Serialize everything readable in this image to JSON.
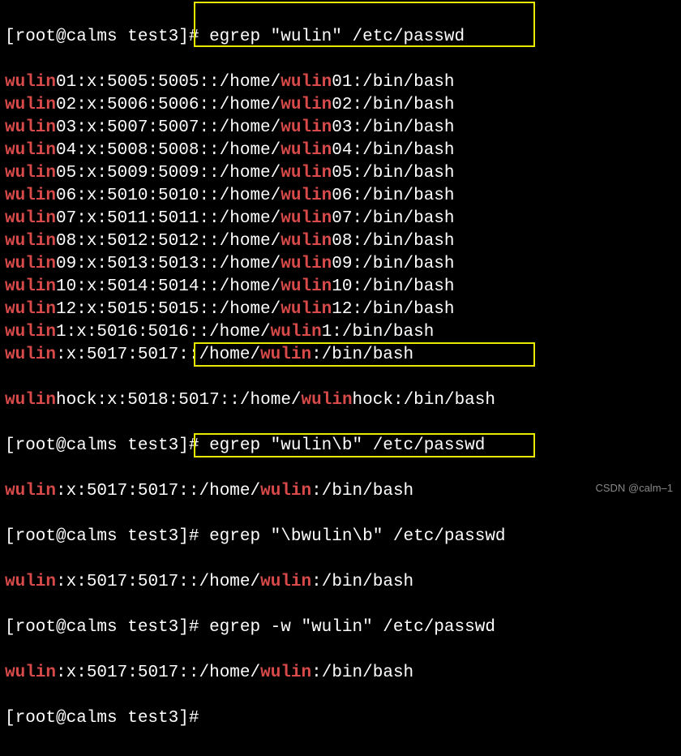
{
  "prompt": "[root@calms test3]#",
  "cmd1": "egrep \"wulin\" /etc/passwd",
  "cmd2": "egrep \"wulin\\b\" /etc/passwd",
  "cmd3": "egrep \"\\bwulin\\b\" /etc/passwd",
  "cmd4": "egrep -w \"wulin\" /etc/passwd",
  "match": "wulin",
  "rows": [
    {
      "n": "01",
      "uid": "5005",
      "gid": "5005",
      "home": "01"
    },
    {
      "n": "02",
      "uid": "5006",
      "gid": "5006",
      "home": "02"
    },
    {
      "n": "03",
      "uid": "5007",
      "gid": "5007",
      "home": "03"
    },
    {
      "n": "04",
      "uid": "5008",
      "gid": "5008",
      "home": "04"
    },
    {
      "n": "05",
      "uid": "5009",
      "gid": "5009",
      "home": "05"
    },
    {
      "n": "06",
      "uid": "5010",
      "gid": "5010",
      "home": "06"
    },
    {
      "n": "07",
      "uid": "5011",
      "gid": "5011",
      "home": "07"
    },
    {
      "n": "08",
      "uid": "5012",
      "gid": "5012",
      "home": "08"
    },
    {
      "n": "09",
      "uid": "5013",
      "gid": "5013",
      "home": "09"
    },
    {
      "n": "10",
      "uid": "5014",
      "gid": "5014",
      "home": "10"
    },
    {
      "n": "12",
      "uid": "5015",
      "gid": "5015",
      "home": "12"
    },
    {
      "n": "1",
      "uid": "5016",
      "gid": "5016",
      "home": "1"
    },
    {
      "n": "",
      "uid": "5017",
      "gid": "5017",
      "home": ""
    }
  ],
  "hockRow": {
    "n": "hock",
    "uid": "5018",
    "gid": "5017",
    "home": "hock"
  },
  "singleRow": {
    "n": "",
    "uid": "5017",
    "gid": "5017",
    "home": ""
  },
  "watermark": "CSDN @calm–1"
}
